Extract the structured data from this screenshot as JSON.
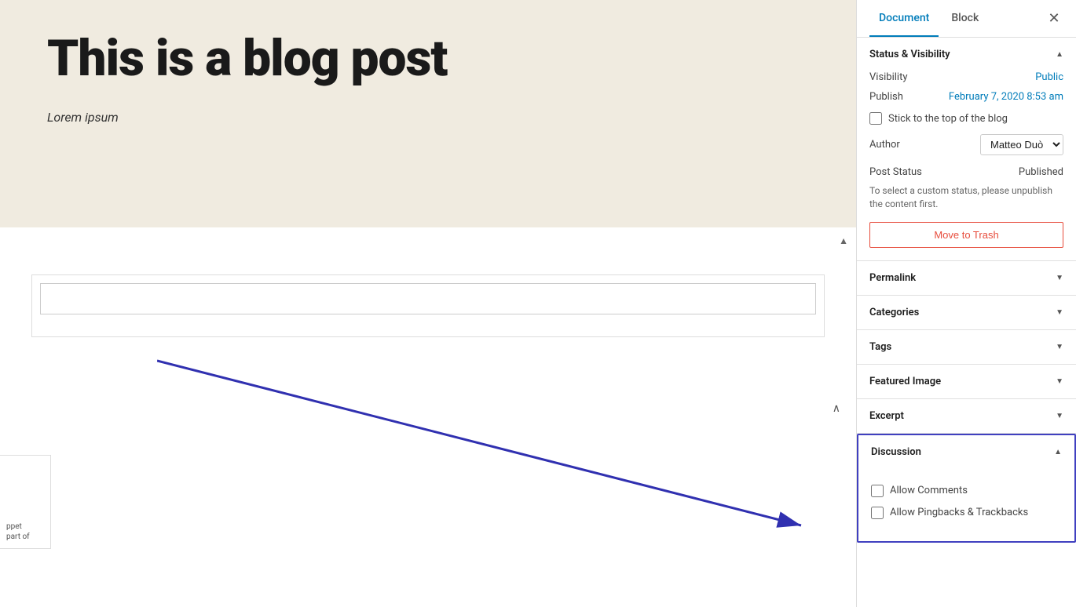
{
  "tabs": {
    "document_label": "Document",
    "block_label": "Block",
    "close_label": "✕"
  },
  "hero": {
    "title": "This is a blog post",
    "subtitle": "Lorem ipsum"
  },
  "status_visibility": {
    "section_title": "Status & Visibility",
    "visibility_label": "Visibility",
    "visibility_value": "Public",
    "publish_label": "Publish",
    "publish_value": "February 7, 2020 8:53 am",
    "stick_to_top_label": "Stick to the top of the blog",
    "author_label": "Author",
    "author_value": "Matteo Duò",
    "post_status_label": "Post Status",
    "post_status_value": "Published",
    "status_hint": "To select a custom status, please unpublish the content first.",
    "move_to_trash_label": "Move to Trash"
  },
  "sections": [
    {
      "id": "permalink",
      "label": "Permalink",
      "expanded": false
    },
    {
      "id": "categories",
      "label": "Categories",
      "expanded": false
    },
    {
      "id": "tags",
      "label": "Tags",
      "expanded": false
    },
    {
      "id": "featured-image",
      "label": "Featured Image",
      "expanded": false
    },
    {
      "id": "excerpt",
      "label": "Excerpt",
      "expanded": false
    }
  ],
  "discussion": {
    "section_title": "Discussion",
    "allow_comments_label": "Allow Comments",
    "allow_pingbacks_label": "Allow Pingbacks & Trackbacks",
    "expanded": true
  },
  "sidebar_stub": {
    "line1": "ppet",
    "line2": "part of"
  }
}
